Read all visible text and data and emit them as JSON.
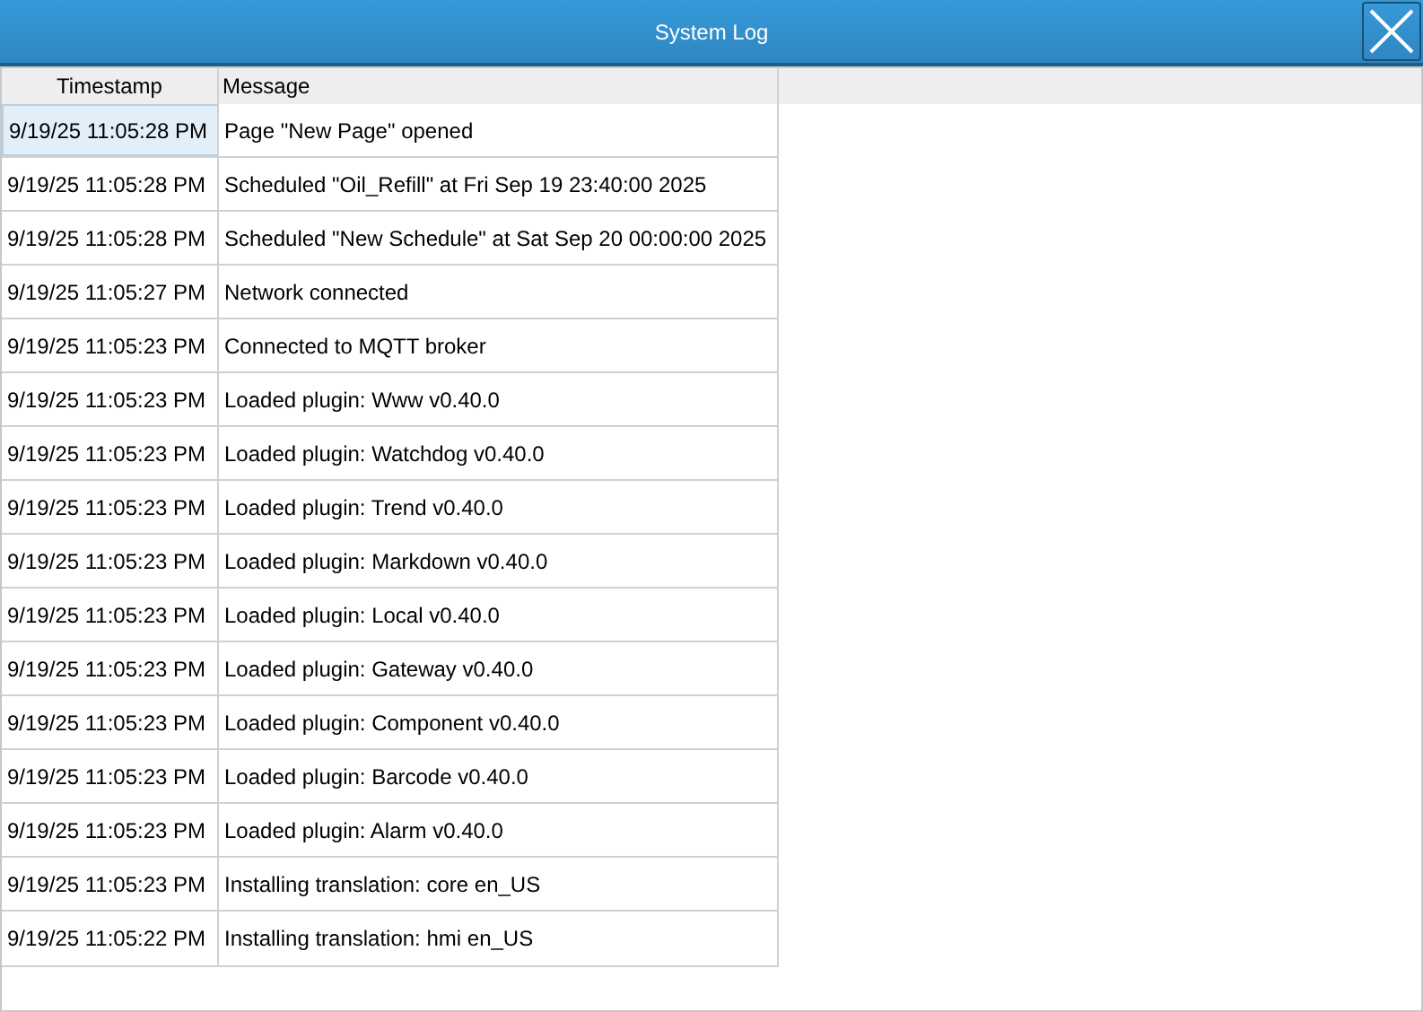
{
  "window": {
    "title": "System Log"
  },
  "table": {
    "columns": [
      "Timestamp",
      "Message"
    ],
    "rows": [
      {
        "timestamp": "9/19/25 11:05:28 PM",
        "message": "Page \"New Page\" opened",
        "selected": true
      },
      {
        "timestamp": "9/19/25 11:05:28 PM",
        "message": "Scheduled \"Oil_Refill\" at Fri Sep 19 23:40:00 2025",
        "selected": false
      },
      {
        "timestamp": "9/19/25 11:05:28 PM",
        "message": "Scheduled \"New Schedule\" at Sat Sep 20 00:00:00 2025",
        "selected": false
      },
      {
        "timestamp": "9/19/25 11:05:27 PM",
        "message": "Network connected",
        "selected": false
      },
      {
        "timestamp": "9/19/25 11:05:23 PM",
        "message": "Connected to MQTT broker",
        "selected": false
      },
      {
        "timestamp": "9/19/25 11:05:23 PM",
        "message": "Loaded plugin: Www v0.40.0",
        "selected": false
      },
      {
        "timestamp": "9/19/25 11:05:23 PM",
        "message": "Loaded plugin: Watchdog v0.40.0",
        "selected": false
      },
      {
        "timestamp": "9/19/25 11:05:23 PM",
        "message": "Loaded plugin: Trend v0.40.0",
        "selected": false
      },
      {
        "timestamp": "9/19/25 11:05:23 PM",
        "message": "Loaded plugin: Markdown v0.40.0",
        "selected": false
      },
      {
        "timestamp": "9/19/25 11:05:23 PM",
        "message": "Loaded plugin: Local v0.40.0",
        "selected": false
      },
      {
        "timestamp": "9/19/25 11:05:23 PM",
        "message": "Loaded plugin: Gateway v0.40.0",
        "selected": false
      },
      {
        "timestamp": "9/19/25 11:05:23 PM",
        "message": "Loaded plugin: Component v0.40.0",
        "selected": false
      },
      {
        "timestamp": "9/19/25 11:05:23 PM",
        "message": "Loaded plugin: Barcode v0.40.0",
        "selected": false
      },
      {
        "timestamp": "9/19/25 11:05:23 PM",
        "message": "Loaded plugin: Alarm v0.40.0",
        "selected": false
      },
      {
        "timestamp": "9/19/25 11:05:23 PM",
        "message": "Installing translation: core en_US",
        "selected": false
      },
      {
        "timestamp": "9/19/25 11:05:22 PM",
        "message": "Installing translation: hmi en_US",
        "selected": false
      }
    ]
  }
}
